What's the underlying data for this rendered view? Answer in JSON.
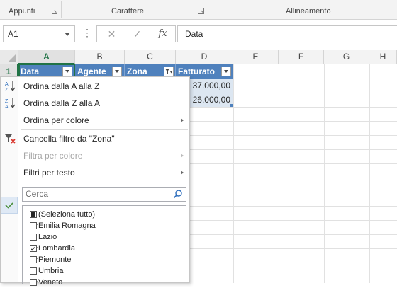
{
  "ribbon": {
    "groups": [
      "Appunti",
      "Carattere",
      "Allineamento"
    ]
  },
  "formula_bar": {
    "name_box": "A1",
    "fx_label": "fx",
    "cancel_glyph": "✕",
    "enter_glyph": "✓",
    "formula_value": "Data"
  },
  "grid": {
    "columns": [
      "A",
      "B",
      "C",
      "D",
      "E",
      "F",
      "G",
      "H"
    ],
    "rows": [
      "1"
    ],
    "headers": [
      "Data",
      "Agente",
      "Zona",
      "Fatturato"
    ],
    "values": [
      "37.000,00",
      "26.000,00"
    ]
  },
  "filter_menu": {
    "sort_az": "Ordina dalla A alla Z",
    "sort_za": "Ordina dalla Z alla A",
    "sort_color": "Ordina per colore",
    "clear_filter": "Cancella filtro da \"Zona\"",
    "filter_color": "Filtra per colore",
    "text_filters": "Filtri per testo",
    "search_placeholder": "Cerca",
    "items": [
      {
        "label": "(Seleziona tutto)",
        "state": "partial"
      },
      {
        "label": "Emilia Romagna",
        "state": "unchecked"
      },
      {
        "label": "Lazio",
        "state": "unchecked"
      },
      {
        "label": "Lombardia",
        "state": "checked"
      },
      {
        "label": "Piemonte",
        "state": "unchecked"
      },
      {
        "label": "Umbria",
        "state": "unchecked"
      },
      {
        "label": "Veneto",
        "state": "unchecked"
      }
    ]
  },
  "colors": {
    "header_fill": "#4f81bd",
    "accent": "#217346",
    "value_fill": "#dce6f1"
  }
}
